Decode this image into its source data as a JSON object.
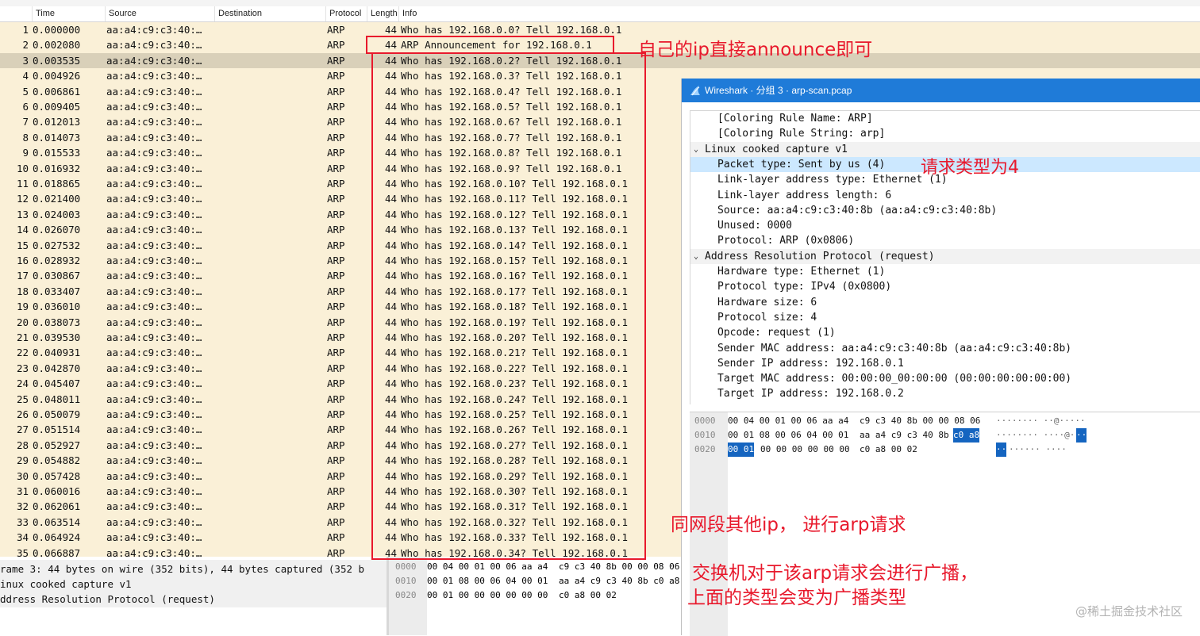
{
  "top_strip_text": "",
  "columns": [
    "Time",
    "Source",
    "Destination",
    "Protocol",
    "Length",
    "Info"
  ],
  "packets": [
    {
      "no": "1",
      "time": "0.000000",
      "src": "aa:a4:c9:c3:40:…",
      "dst": "",
      "proto": "ARP",
      "len": "44",
      "info": "Who has 192.168.0.0? Tell 192.168.0.1"
    },
    {
      "no": "2",
      "time": "0.002080",
      "src": "aa:a4:c9:c3:40:…",
      "dst": "",
      "proto": "ARP",
      "len": "44",
      "info": "ARP Announcement for 192.168.0.1"
    },
    {
      "no": "3",
      "time": "0.003535",
      "src": "aa:a4:c9:c3:40:…",
      "dst": "",
      "proto": "ARP",
      "len": "44",
      "info": "Who has 192.168.0.2? Tell 192.168.0.1"
    },
    {
      "no": "4",
      "time": "0.004926",
      "src": "aa:a4:c9:c3:40:…",
      "dst": "",
      "proto": "ARP",
      "len": "44",
      "info": "Who has 192.168.0.3? Tell 192.168.0.1"
    },
    {
      "no": "5",
      "time": "0.006861",
      "src": "aa:a4:c9:c3:40:…",
      "dst": "",
      "proto": "ARP",
      "len": "44",
      "info": "Who has 192.168.0.4? Tell 192.168.0.1"
    },
    {
      "no": "6",
      "time": "0.009405",
      "src": "aa:a4:c9:c3:40:…",
      "dst": "",
      "proto": "ARP",
      "len": "44",
      "info": "Who has 192.168.0.5? Tell 192.168.0.1"
    },
    {
      "no": "7",
      "time": "0.012013",
      "src": "aa:a4:c9:c3:40:…",
      "dst": "",
      "proto": "ARP",
      "len": "44",
      "info": "Who has 192.168.0.6? Tell 192.168.0.1"
    },
    {
      "no": "8",
      "time": "0.014073",
      "src": "aa:a4:c9:c3:40:…",
      "dst": "",
      "proto": "ARP",
      "len": "44",
      "info": "Who has 192.168.0.7? Tell 192.168.0.1"
    },
    {
      "no": "9",
      "time": "0.015533",
      "src": "aa:a4:c9:c3:40:…",
      "dst": "",
      "proto": "ARP",
      "len": "44",
      "info": "Who has 192.168.0.8? Tell 192.168.0.1"
    },
    {
      "no": "10",
      "time": "0.016932",
      "src": "aa:a4:c9:c3:40:…",
      "dst": "",
      "proto": "ARP",
      "len": "44",
      "info": "Who has 192.168.0.9? Tell 192.168.0.1"
    },
    {
      "no": "11",
      "time": "0.018865",
      "src": "aa:a4:c9:c3:40:…",
      "dst": "",
      "proto": "ARP",
      "len": "44",
      "info": "Who has 192.168.0.10? Tell 192.168.0.1"
    },
    {
      "no": "12",
      "time": "0.021400",
      "src": "aa:a4:c9:c3:40:…",
      "dst": "",
      "proto": "ARP",
      "len": "44",
      "info": "Who has 192.168.0.11? Tell 192.168.0.1"
    },
    {
      "no": "13",
      "time": "0.024003",
      "src": "aa:a4:c9:c3:40:…",
      "dst": "",
      "proto": "ARP",
      "len": "44",
      "info": "Who has 192.168.0.12? Tell 192.168.0.1"
    },
    {
      "no": "14",
      "time": "0.026070",
      "src": "aa:a4:c9:c3:40:…",
      "dst": "",
      "proto": "ARP",
      "len": "44",
      "info": "Who has 192.168.0.13? Tell 192.168.0.1"
    },
    {
      "no": "15",
      "time": "0.027532",
      "src": "aa:a4:c9:c3:40:…",
      "dst": "",
      "proto": "ARP",
      "len": "44",
      "info": "Who has 192.168.0.14? Tell 192.168.0.1"
    },
    {
      "no": "16",
      "time": "0.028932",
      "src": "aa:a4:c9:c3:40:…",
      "dst": "",
      "proto": "ARP",
      "len": "44",
      "info": "Who has 192.168.0.15? Tell 192.168.0.1"
    },
    {
      "no": "17",
      "time": "0.030867",
      "src": "aa:a4:c9:c3:40:…",
      "dst": "",
      "proto": "ARP",
      "len": "44",
      "info": "Who has 192.168.0.16? Tell 192.168.0.1"
    },
    {
      "no": "18",
      "time": "0.033407",
      "src": "aa:a4:c9:c3:40:…",
      "dst": "",
      "proto": "ARP",
      "len": "44",
      "info": "Who has 192.168.0.17? Tell 192.168.0.1"
    },
    {
      "no": "19",
      "time": "0.036010",
      "src": "aa:a4:c9:c3:40:…",
      "dst": "",
      "proto": "ARP",
      "len": "44",
      "info": "Who has 192.168.0.18? Tell 192.168.0.1"
    },
    {
      "no": "20",
      "time": "0.038073",
      "src": "aa:a4:c9:c3:40:…",
      "dst": "",
      "proto": "ARP",
      "len": "44",
      "info": "Who has 192.168.0.19? Tell 192.168.0.1"
    },
    {
      "no": "21",
      "time": "0.039530",
      "src": "aa:a4:c9:c3:40:…",
      "dst": "",
      "proto": "ARP",
      "len": "44",
      "info": "Who has 192.168.0.20? Tell 192.168.0.1"
    },
    {
      "no": "22",
      "time": "0.040931",
      "src": "aa:a4:c9:c3:40:…",
      "dst": "",
      "proto": "ARP",
      "len": "44",
      "info": "Who has 192.168.0.21? Tell 192.168.0.1"
    },
    {
      "no": "23",
      "time": "0.042870",
      "src": "aa:a4:c9:c3:40:…",
      "dst": "",
      "proto": "ARP",
      "len": "44",
      "info": "Who has 192.168.0.22? Tell 192.168.0.1"
    },
    {
      "no": "24",
      "time": "0.045407",
      "src": "aa:a4:c9:c3:40:…",
      "dst": "",
      "proto": "ARP",
      "len": "44",
      "info": "Who has 192.168.0.23? Tell 192.168.0.1"
    },
    {
      "no": "25",
      "time": "0.048011",
      "src": "aa:a4:c9:c3:40:…",
      "dst": "",
      "proto": "ARP",
      "len": "44",
      "info": "Who has 192.168.0.24? Tell 192.168.0.1"
    },
    {
      "no": "26",
      "time": "0.050079",
      "src": "aa:a4:c9:c3:40:…",
      "dst": "",
      "proto": "ARP",
      "len": "44",
      "info": "Who has 192.168.0.25? Tell 192.168.0.1"
    },
    {
      "no": "27",
      "time": "0.051514",
      "src": "aa:a4:c9:c3:40:…",
      "dst": "",
      "proto": "ARP",
      "len": "44",
      "info": "Who has 192.168.0.26? Tell 192.168.0.1"
    },
    {
      "no": "28",
      "time": "0.052927",
      "src": "aa:a4:c9:c3:40:…",
      "dst": "",
      "proto": "ARP",
      "len": "44",
      "info": "Who has 192.168.0.27? Tell 192.168.0.1"
    },
    {
      "no": "29",
      "time": "0.054882",
      "src": "aa:a4:c9:c3:40:…",
      "dst": "",
      "proto": "ARP",
      "len": "44",
      "info": "Who has 192.168.0.28? Tell 192.168.0.1"
    },
    {
      "no": "30",
      "time": "0.057428",
      "src": "aa:a4:c9:c3:40:…",
      "dst": "",
      "proto": "ARP",
      "len": "44",
      "info": "Who has 192.168.0.29? Tell 192.168.0.1"
    },
    {
      "no": "31",
      "time": "0.060016",
      "src": "aa:a4:c9:c3:40:…",
      "dst": "",
      "proto": "ARP",
      "len": "44",
      "info": "Who has 192.168.0.30? Tell 192.168.0.1"
    },
    {
      "no": "32",
      "time": "0.062061",
      "src": "aa:a4:c9:c3:40:…",
      "dst": "",
      "proto": "ARP",
      "len": "44",
      "info": "Who has 192.168.0.31? Tell 192.168.0.1"
    },
    {
      "no": "33",
      "time": "0.063514",
      "src": "aa:a4:c9:c3:40:…",
      "dst": "",
      "proto": "ARP",
      "len": "44",
      "info": "Who has 192.168.0.32? Tell 192.168.0.1"
    },
    {
      "no": "34",
      "time": "0.064924",
      "src": "aa:a4:c9:c3:40:…",
      "dst": "",
      "proto": "ARP",
      "len": "44",
      "info": "Who has 192.168.0.33? Tell 192.168.0.1"
    },
    {
      "no": "35",
      "time": "0.066887",
      "src": "aa:a4:c9:c3:40:…",
      "dst": "",
      "proto": "ARP",
      "len": "44",
      "info": "Who has 192.168.0.34? Tell 192.168.0.1"
    }
  ],
  "selected_packet": "3",
  "bottom_details": [
    "rame 3: 44 bytes on wire (352 bits), 44 bytes captured (352 b",
    "inux cooked capture v1",
    "ddress Resolution Protocol (request)"
  ],
  "bottom_bytes": [
    {
      "offset": "0000",
      "hex1": "00 04 00 01 00 06 aa a4",
      "hex2": "c9 c3 40 8b 00 00 08 06"
    },
    {
      "offset": "0010",
      "hex1": "00 01 08 00 06 04 00 01",
      "hex2": "aa a4 c9 c3 40 8b c0 a8"
    },
    {
      "offset": "0020",
      "hex1": "00 01 00 00 00 00 00 00",
      "hex2": "c0 a8 00 02"
    }
  ],
  "popup": {
    "title": "Wireshark · 分组 3 · arp-scan.pcap",
    "tree": [
      {
        "text": "[Coloring Rule Name: ARP]",
        "indent": 1
      },
      {
        "text": "[Coloring Rule String: arp]",
        "indent": 1
      },
      {
        "text": "Linux cooked capture v1",
        "indent": 0,
        "caret": "v"
      },
      {
        "text": "Packet type: Sent by us (4)",
        "indent": 1,
        "highlight": true
      },
      {
        "text": "Link-layer address type: Ethernet (1)",
        "indent": 1
      },
      {
        "text": "Link-layer address length: 6",
        "indent": 1
      },
      {
        "text": "Source: aa:a4:c9:c3:40:8b (aa:a4:c9:c3:40:8b)",
        "indent": 1
      },
      {
        "text": "Unused: 0000",
        "indent": 1
      },
      {
        "text": "Protocol: ARP (0x0806)",
        "indent": 1
      },
      {
        "text": "Address Resolution Protocol (request)",
        "indent": 0,
        "caret": "v"
      },
      {
        "text": "Hardware type: Ethernet (1)",
        "indent": 1
      },
      {
        "text": "Protocol type: IPv4 (0x0800)",
        "indent": 1
      },
      {
        "text": "Hardware size: 6",
        "indent": 1
      },
      {
        "text": "Protocol size: 4",
        "indent": 1
      },
      {
        "text": "Opcode: request (1)",
        "indent": 1
      },
      {
        "text": "Sender MAC address: aa:a4:c9:c3:40:8b (aa:a4:c9:c3:40:8b)",
        "indent": 1
      },
      {
        "text": "Sender IP address: 192.168.0.1",
        "indent": 1
      },
      {
        "text": "Target MAC address: 00:00:00_00:00:00 (00:00:00:00:00:00)",
        "indent": 1
      },
      {
        "text": "Target IP address: 192.168.0.2",
        "indent": 1
      }
    ],
    "bytes": [
      {
        "offset": "0000",
        "hex1": "00 04 00 01 00 06 aa a4",
        "hex2": "c9 c3 40 8b 00 00 08 06",
        "hex_hl": "",
        "ascii": "········ ··@·····",
        "ascii_hl": ""
      },
      {
        "offset": "0010",
        "hex1": "00 01 08 00 06 04 00 01",
        "hex2": "aa a4 c9 c3 40 8b",
        "hex_hl": "c0 a8",
        "ascii": "········ ····@·",
        "ascii_hl": "··"
      },
      {
        "offset": "0020",
        "hex1": "",
        "hex_hl1": "00 01",
        "hex1_rest": "00 00 00 00 00 00",
        "hex2": "c0 a8 00 02",
        "ascii": "······ ····",
        "ascii_hl": "··"
      }
    ]
  },
  "annotations": {
    "announce": "自己的ip直接announce即可",
    "request_type": "请求类型为4",
    "same_subnet": "同网段其他ip， 进行arp请求",
    "switch_line1": "交换机对于该arp请求会进行广播，",
    "switch_line2": "上面的类型会变为广播类型"
  },
  "watermark": "@稀土掘金技术社区",
  "colors": {
    "annotation": "#e8192c",
    "title_bar": "#1f7bd8",
    "list_bg": "#faf0d7",
    "selected_row": "#d9d0b9",
    "tree_highlight": "#cce8ff",
    "byte_highlight": "#1565c0"
  },
  "icons": {
    "popup_title": "wireshark-fin-icon",
    "tree_expand": "chevron-down-icon"
  }
}
